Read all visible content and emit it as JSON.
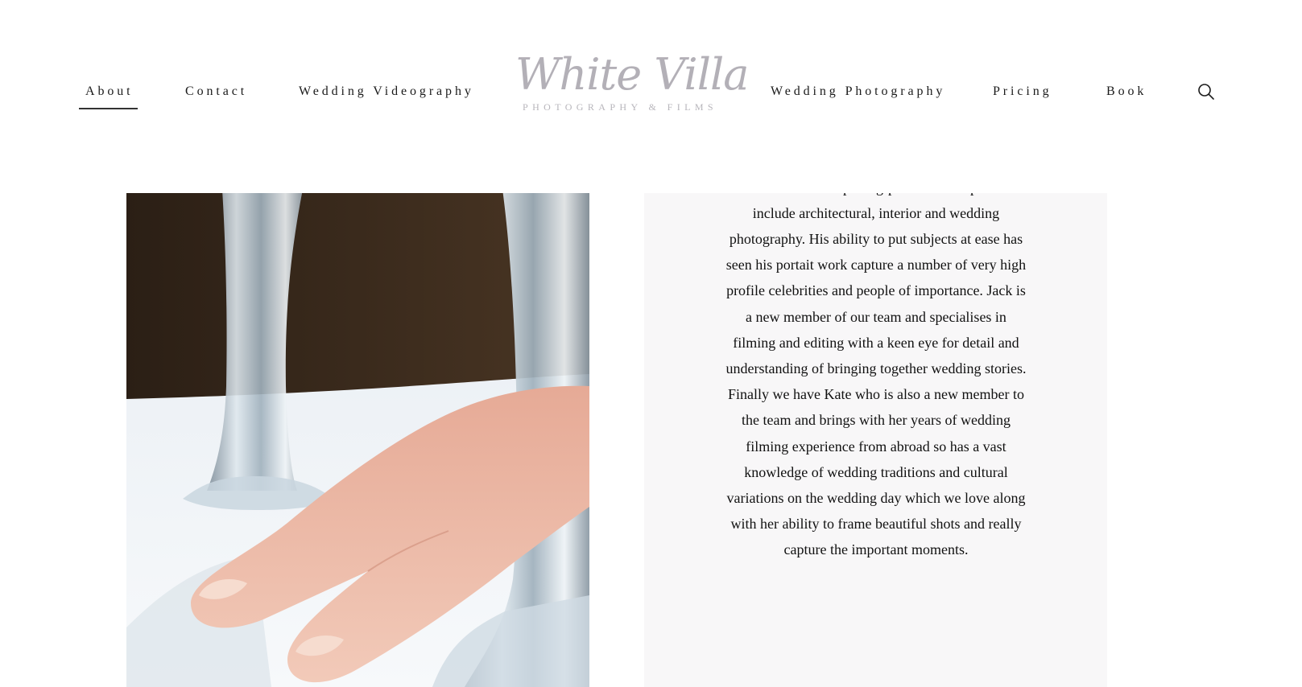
{
  "nav": {
    "left": [
      {
        "label": "About",
        "active": true
      },
      {
        "label": "Contact"
      },
      {
        "label": "Wedding Videography"
      }
    ],
    "right": [
      {
        "label": "Wedding Photography"
      },
      {
        "label": "Pricing"
      },
      {
        "label": "Book"
      }
    ],
    "search_icon": "search-icon"
  },
  "logo": {
    "script": "White Villa",
    "subtitle": "PHOTOGRAPHY & FILMS"
  },
  "about": {
    "paragraph": "with many, many years of wedding photography experience to his name and knows how to maximise your event and get you what you want from it. Charlie is our other photogrpaher whose specialties include architectural, interior and wedding photography. His ability to put subjects at ease has seen his portait work capture a number of very high profile celebrities and people of importance. Jack is a new member of our team and specialises in filming and editing with a keen eye for detail and understanding of bringing together wedding stories. Finally we have Kate who is also a new member to the team and brings with her years of wedding filming experience from abroad so has a vast knowledge of wedding traditions and cultural variations on the wedding day which we love along with her ability to frame beautiful shots and really capture the important moments."
  },
  "colors": {
    "panel_bg": "#f8f7f8",
    "logo_grey": "#b3b0b7",
    "text": "#111111"
  }
}
